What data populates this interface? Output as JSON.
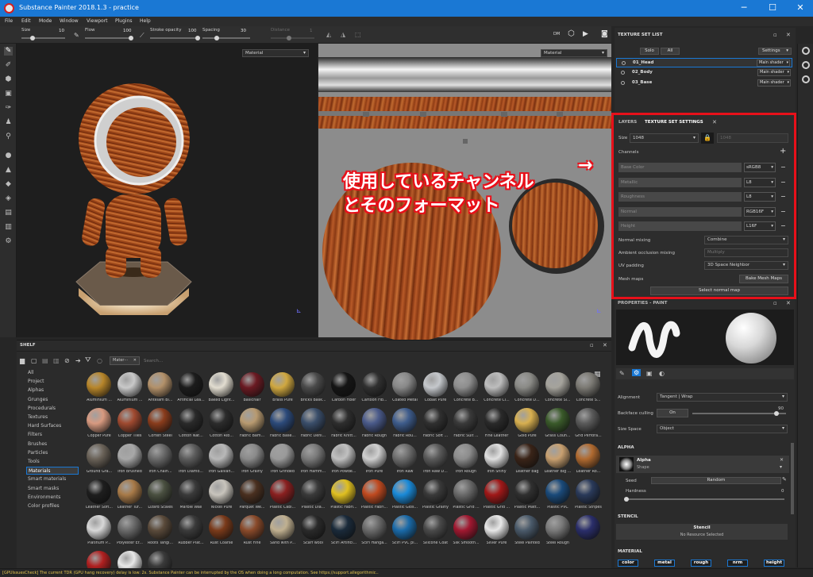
{
  "window": {
    "title": "Substance Painter 2018.1.3 - practice",
    "minimize": "─",
    "maximize": "☐",
    "close": "✕"
  },
  "menu": [
    "File",
    "Edit",
    "Mode",
    "Window",
    "Viewport",
    "Plugins",
    "Help"
  ],
  "toolbar": {
    "size_label": "Size",
    "size_value": "10",
    "flow_label": "Flow",
    "flow_value": "100",
    "stroke_opacity_label": "Stroke opacity",
    "stroke_opacity_value": "100",
    "spacing_label": "Spacing",
    "spacing_value": "30",
    "distance_label": "Distance",
    "distance_value": "1",
    "size_level": 0.25,
    "flow_level": 1.0,
    "stroke_opacity_level": 1.0,
    "spacing_level": 0.3
  },
  "viewport_3d": {
    "dropdown": "Material"
  },
  "viewport_2d": {
    "dropdown": "Material",
    "cam_label": "Cam"
  },
  "shelf": {
    "title": "SHELF",
    "filter_chip": "Mater···",
    "search_placeholder": "Search...",
    "categories": [
      "All",
      "Project",
      "Alphas",
      "Grunges",
      "Procedurals",
      "Textures",
      "Hard Surfaces",
      "Filters",
      "Brushes",
      "Particles",
      "Tools",
      "Materials",
      "Smart materials",
      "Smart masks",
      "Environments",
      "Color profiles"
    ],
    "selected_category": "Materials",
    "materials": [
      {
        "name": "Aluminium ...",
        "color": "#b8862a"
      },
      {
        "name": "Aluminium ...",
        "color": "#c9c9c9"
      },
      {
        "name": "Antelam Bl...",
        "color": "#b3916a"
      },
      {
        "name": "Artificial Lea...",
        "color": "#1c1c1c"
      },
      {
        "name": "Baked Light...",
        "color": "#e2ddd0"
      },
      {
        "name": "Basichair",
        "color": "#6a1a22"
      },
      {
        "name": "Brass Pure",
        "color": "#d0a840"
      },
      {
        "name": "Bricks Bask...",
        "color": "#4a4a4a"
      },
      {
        "name": "Carbon Fiber",
        "color": "#151515"
      },
      {
        "name": "Cartoon Fib...",
        "color": "#303030"
      },
      {
        "name": "Coated Metal",
        "color": "#888888"
      },
      {
        "name": "Cobalt Pure",
        "color": "#c5c8cc"
      },
      {
        "name": "Concrete B...",
        "color": "#8e8e8e"
      },
      {
        "name": "Concrete Cl...",
        "color": "#bdbdbd"
      },
      {
        "name": "Concrete D...",
        "color": "#8a8a86"
      },
      {
        "name": "Concrete Si...",
        "color": "#a5a39c"
      },
      {
        "name": "Concrete S...",
        "color": "#7c7a74"
      },
      {
        "name": "Copper Pure",
        "color": "#d89a80"
      },
      {
        "name": "Copper Tiles",
        "color": "#a04a30"
      },
      {
        "name": "Corten Steel",
        "color": "#8a3c1c"
      },
      {
        "name": "Cotton Nat...",
        "color": "#2a2a2a"
      },
      {
        "name": "Cotton Rib...",
        "color": "#2c2c2c"
      },
      {
        "name": "Fabric Bam...",
        "color": "#b89a70"
      },
      {
        "name": "Fabric Base...",
        "color": "#2c4a7a"
      },
      {
        "name": "Fabric Deni...",
        "color": "#3a4e6a"
      },
      {
        "name": "Fabric Knitt...",
        "color": "#2e2e2e"
      },
      {
        "name": "Fabric Rough",
        "color": "#4a5a8a"
      },
      {
        "name": "Fabric Rou...",
        "color": "#3e5c8c"
      },
      {
        "name": "Fabric Soft ...",
        "color": "#303030"
      },
      {
        "name": "Fabric Suit ...",
        "color": "#3a3a3a"
      },
      {
        "name": "Fine Leather",
        "color": "#2a2a2a"
      },
      {
        "name": "Gold Pure",
        "color": "#d8b050"
      },
      {
        "name": "Grass Coun...",
        "color": "#3a5a2a"
      },
      {
        "name": "Grid Perfora...",
        "color": "#5a5a5a"
      },
      {
        "name": "Ground Gra...",
        "color": "#6a6258"
      },
      {
        "name": "Iron Brushed",
        "color": "#a8a8a8"
      },
      {
        "name": "Iron Chain...",
        "color": "#6a6a6a"
      },
      {
        "name": "Iron Diamo...",
        "color": "#5c5c5c"
      },
      {
        "name": "Iron Galvan...",
        "color": "#b8b8b8"
      },
      {
        "name": "Iron Grainy",
        "color": "#8a8a8a"
      },
      {
        "name": "Iron Grinded",
        "color": "#9a9a9a"
      },
      {
        "name": "Iron Hamm...",
        "color": "#7a7a7a"
      },
      {
        "name": "Iron Powde...",
        "color": "#c0c0c0"
      },
      {
        "name": "Iron Pure",
        "color": "#d0d0d0"
      },
      {
        "name": "Iron Raw",
        "color": "#6e6e6e"
      },
      {
        "name": "Iron Raw D...",
        "color": "#5a5a5a"
      },
      {
        "name": "Iron Rough",
        "color": "#8c8c8c"
      },
      {
        "name": "Iron Shiny",
        "color": "#e0e0e0"
      },
      {
        "name": "Leather bag",
        "color": "#3a2418"
      },
      {
        "name": "Leather Big ...",
        "color": "#c8a070"
      },
      {
        "name": "Leather Ro...",
        "color": "#b06a30"
      },
      {
        "name": "Leather Soft...",
        "color": "#1e1e1e"
      },
      {
        "name": "Leather Tur...",
        "color": "#a87a48"
      },
      {
        "name": "Lizard Scales",
        "color": "#4a5040"
      },
      {
        "name": "Marble Wall",
        "color": "#3a3a3a"
      },
      {
        "name": "Nickel Pure",
        "color": "#c8c4bc"
      },
      {
        "name": "Parquet We...",
        "color": "#4a3020"
      },
      {
        "name": "Plastic Cabl...",
        "color": "#8a2020"
      },
      {
        "name": "Plastic Dia...",
        "color": "#3a3a3a"
      },
      {
        "name": "Plastic Fabri...",
        "color": "#e0c020"
      },
      {
        "name": "Plastic Fabri...",
        "color": "#c04a20"
      },
      {
        "name": "Plastic Glos...",
        "color": "#1a8ad8"
      },
      {
        "name": "Plastic Grainy",
        "color": "#3a3a3a"
      },
      {
        "name": "Plastic Grid ...",
        "color": "#6a6a6a"
      },
      {
        "name": "Plastic Grid ...",
        "color": "#a01818"
      },
      {
        "name": "Plastic Matt...",
        "color": "#303030"
      },
      {
        "name": "Plastic PVC",
        "color": "#1a4a7a"
      },
      {
        "name": "Plastic Stripes",
        "color": "#2a3a5a"
      },
      {
        "name": "Platinum P...",
        "color": "#d8d8d8"
      },
      {
        "name": "Polyester Er...",
        "color": "#6a6a6a"
      },
      {
        "name": "Roots Tangl...",
        "color": "#5a4a3a"
      },
      {
        "name": "Rubber Plat...",
        "color": "#3a3a3a"
      },
      {
        "name": "Rust Coarse",
        "color": "#7a3a1a"
      },
      {
        "name": "Rust Fine",
        "color": "#8a4a2a"
      },
      {
        "name": "Sand with P...",
        "color": "#c0b090"
      },
      {
        "name": "Scarf wool",
        "color": "#2a2a2a"
      },
      {
        "name": "SciFi Artifici...",
        "color": "#1a2a3a"
      },
      {
        "name": "SciFi Hanga...",
        "color": "#6a6a6a"
      },
      {
        "name": "SciFi PVC pl...",
        "color": "#1a6aa8"
      },
      {
        "name": "Silicone Coat",
        "color": "#4a4a4a"
      },
      {
        "name": "Silk Smooth...",
        "color": "#a01830"
      },
      {
        "name": "Silver Pure",
        "color": "#e8e8e8"
      },
      {
        "name": "Steel Painted",
        "color": "#4a5a6a"
      },
      {
        "name": "Steel Rough",
        "color": "#7a7a7a"
      },
      {
        "name": "",
        "color": "#2a2e6a"
      },
      {
        "name": "",
        "color": "#b02020"
      },
      {
        "name": "",
        "color": "#e8e8e8"
      },
      {
        "name": "",
        "color": "#3a3a3a"
      }
    ]
  },
  "texture_set_list": {
    "title": "TEXTURE SET LIST",
    "solo": "Solo",
    "all": "All",
    "settings": "Settings",
    "rows": [
      {
        "name": "01_Head",
        "shader": "Main shader"
      },
      {
        "name": "02_Body",
        "shader": "Main shader"
      },
      {
        "name": "03_Base",
        "shader": "Main shader"
      }
    ]
  },
  "texture_set_settings": {
    "tab_layers": "LAYERS",
    "tab_settings": "TEXTURE SET SETTINGS",
    "size_label": "Size",
    "size_value": "1048",
    "size_right": "1048",
    "channels_label": "Channels",
    "channels": [
      {
        "name": "Base Color",
        "format": "sRGB8"
      },
      {
        "name": "Metallic",
        "format": "L8"
      },
      {
        "name": "Roughness",
        "format": "L8"
      },
      {
        "name": "Normal",
        "format": "RGB16F"
      },
      {
        "name": "Height",
        "format": "L16F"
      }
    ],
    "normal_mixing_label": "Normal mixing",
    "normal_mixing_value": "Combine",
    "ao_mixing_label": "Ambient occlusion mixing",
    "ao_mixing_value": "Multiply",
    "uv_padding_label": "UV padding",
    "uv_padding_value": "3D Space Neighbor",
    "mesh_maps_label": "Mesh maps",
    "bake_button": "Bake Mesh Maps",
    "select_normal_map": "Select normal map"
  },
  "callout": {
    "line1": "使用しているチャンネル",
    "line2": "とそのフォーマット",
    "arrow": "→"
  },
  "properties": {
    "title": "PROPERTIES - PAINT",
    "alignment_label": "Alignment",
    "alignment_value": "Tangent | Wrap",
    "backface_label": "Backface culling",
    "backface_value": "On",
    "backface_number": "90",
    "backface_level": 0.9,
    "size_space_label": "Size Space",
    "size_space_value": "Object",
    "alpha_header": "ALPHA",
    "alpha_name": "Alpha",
    "alpha_sub": "Shape",
    "seed_label": "Seed",
    "seed_value": "Random",
    "hardness_label": "Hardness",
    "hardness_value": "0",
    "stencil_header": "STENCIL",
    "stencil_name": "Stencil",
    "stencil_sub": "No Resource Selected",
    "material_header": "MATERIAL",
    "material_buttons": [
      "color",
      "metal",
      "rough",
      "nrm",
      "height"
    ]
  },
  "status": "[GPUIssuesCheck] The current TDR (GPU hang recovery) delay is low: 2s. Substance Painter can be interrupted by the OS when doing a long computation. See https://support.allegorithmic.."
}
